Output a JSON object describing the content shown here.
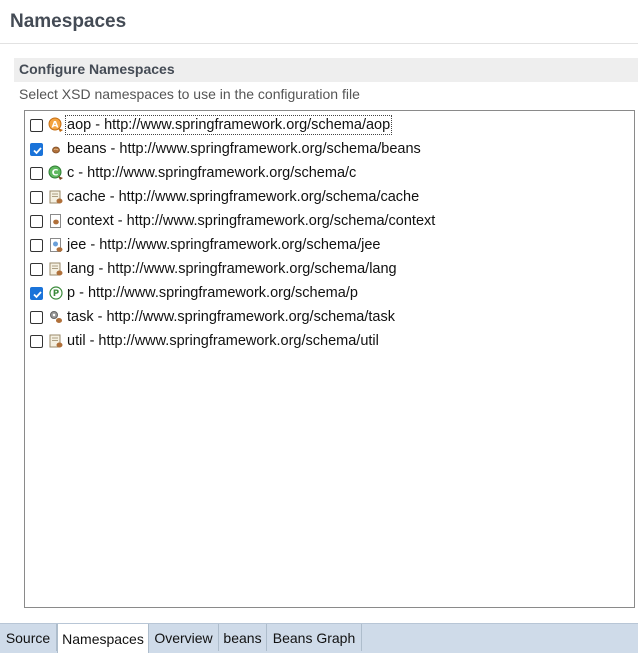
{
  "page": {
    "title": "Namespaces"
  },
  "section": {
    "title": "Configure Namespaces",
    "description": "Select XSD namespaces to use in the configuration file"
  },
  "namespaces": [
    {
      "label": "aop - http://www.springframework.org/schema/aop",
      "checked": false,
      "icon": "aop-icon"
    },
    {
      "label": "beans - http://www.springframework.org/schema/beans",
      "checked": true,
      "icon": "bean-icon"
    },
    {
      "label": "c - http://www.springframework.org/schema/c",
      "checked": false,
      "icon": "c-namespace-icon"
    },
    {
      "label": "cache - http://www.springframework.org/schema/cache",
      "checked": false,
      "icon": "cache-icon"
    },
    {
      "label": "context - http://www.springframework.org/schema/context",
      "checked": false,
      "icon": "context-icon"
    },
    {
      "label": "jee - http://www.springframework.org/schema/jee",
      "checked": false,
      "icon": "jee-icon"
    },
    {
      "label": "lang - http://www.springframework.org/schema/lang",
      "checked": false,
      "icon": "lang-icon"
    },
    {
      "label": "p - http://www.springframework.org/schema/p",
      "checked": true,
      "icon": "p-namespace-icon"
    },
    {
      "label": "task - http://www.springframework.org/schema/task",
      "checked": false,
      "icon": "task-icon"
    },
    {
      "label": "util - http://www.springframework.org/schema/util",
      "checked": false,
      "icon": "util-icon"
    }
  ],
  "tabs": [
    {
      "label": "Source",
      "active": false
    },
    {
      "label": "Namespaces",
      "active": true
    },
    {
      "label": "Overview",
      "active": false
    },
    {
      "label": "beans",
      "active": false
    },
    {
      "label": "Beans Graph",
      "active": false
    }
  ],
  "colors": {
    "checkbox_checked": "#1a73d9",
    "tab_bar": "#cfdbe9",
    "title_text": "#444b55"
  }
}
